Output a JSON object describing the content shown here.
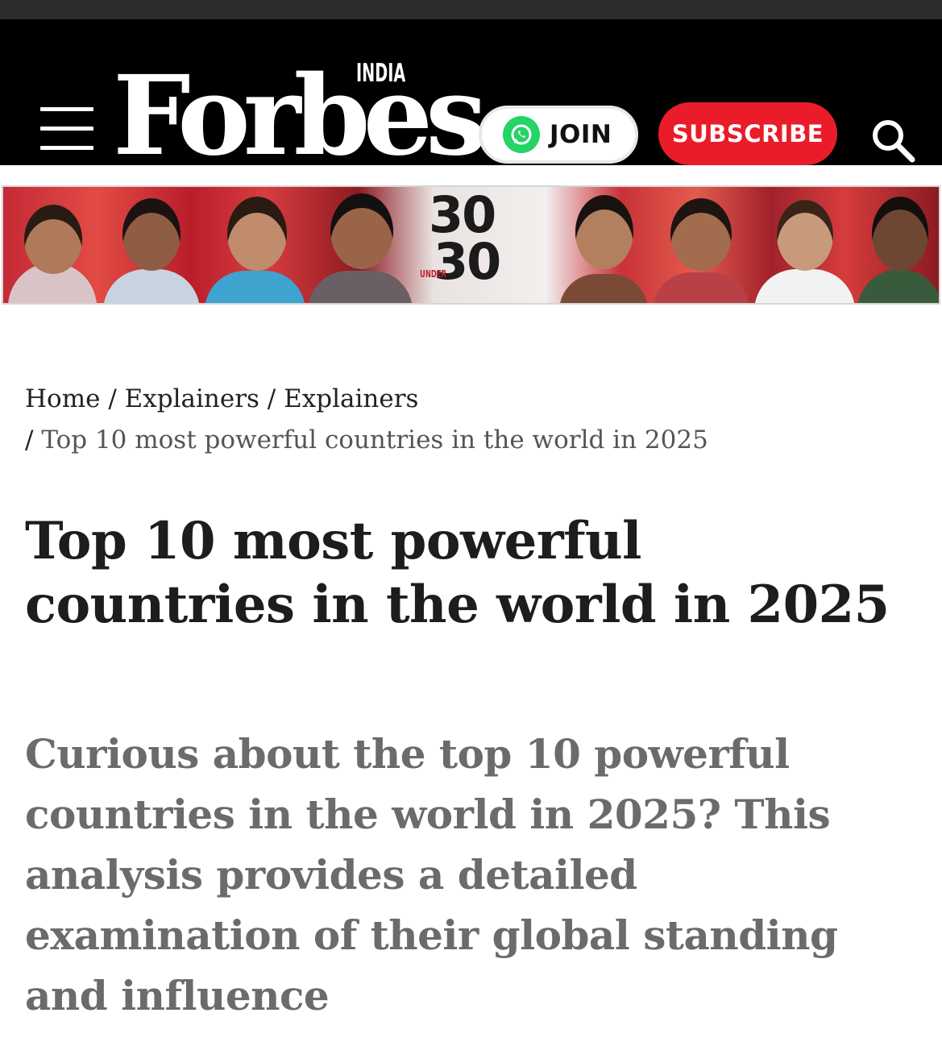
{
  "header": {
    "logo_text": "Forbes",
    "logo_edition": "INDIA",
    "join_label": "JOIN",
    "subscribe_label": "SUBSCRIBE"
  },
  "banner": {
    "top_number": "30",
    "bottom_number": "30",
    "under_label": "UNDER"
  },
  "breadcrumb": {
    "items": [
      "Home",
      "Explainers",
      "Explainers"
    ],
    "separator": "/",
    "current": "Top 10 most powerful countries in the world in 2025"
  },
  "article": {
    "title": "Top 10 most powerful countries in the world in 2025",
    "dek": "Curious about the top 10 powerful countries in the world in 2025? This analysis provides a detailed examination of their global standing and influence"
  },
  "colors": {
    "header_bg": "#000000",
    "subscribe_bg": "#ea1c2a",
    "whatsapp_green": "#25d366",
    "headline": "#1e1c1c",
    "dek": "#6c6a6a"
  }
}
